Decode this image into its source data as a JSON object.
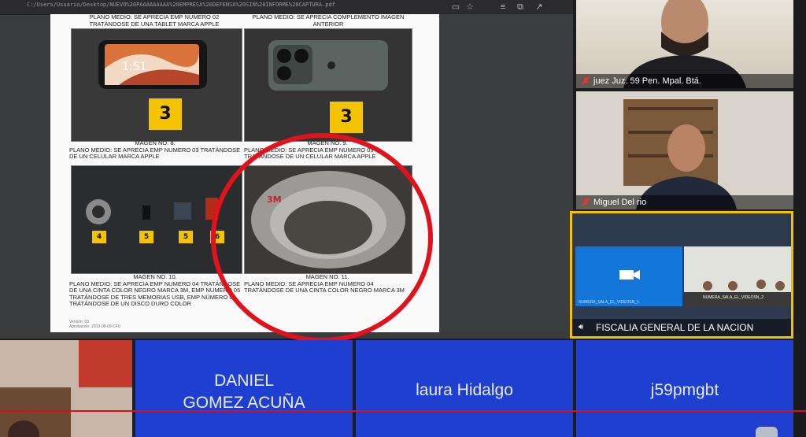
{
  "browser": {
    "url": "C:/Users/Usuario/Desktop/NUEVO%20PAAAAAAAAA%20EMPRESA%20DEFENSA%20SIN%20INFORME%20CAPTURA.pdf",
    "icons": [
      "tab-icon",
      "star-icon",
      "favorites-icon",
      "collections-icon",
      "share-icon"
    ]
  },
  "document": {
    "top_left_caption": "PLANO MEDIO: SE APRECIA EMP NUMERO 02 TRATÁNDOSE DE UNA TABLET MARCA APPLE",
    "top_right_caption": "PLANO MEDIO: SE APRECIA COMPLEMENTO IMAGEN ANTERIOR",
    "marker_top_left": "3",
    "marker_top_right": "3",
    "image8_label": "MAGEN No. 8.",
    "image8_caption": "PLANO MEDIO: SE APRECIA EMP NUMERO 03 TRATÁNDOSE DE UN CELULAR MARCA APPLE",
    "image9_label": "MAGEN No. 9.",
    "image9_caption": "PLANO MEDIO: SE APRECIA EMP NUMERO 03 TRATÁNDOSE DE UN CELULAR MARCA APPLE",
    "image10_label": "MAGEN No. 10.",
    "image10_caption": "PLANO MEDIO: SE APRECIA EMP NUMERO 04 TRATÁNDOSE DE UNA CINTA COLOR NEGRO MARCA 3M, EMP NUMERO 05 TRATÁNDOSE DE TRES MEMORIAS USB, EMP NÚMERO 06 TRATÁNDOSE DE UN DISCO DURO COLOR",
    "image11_label": "MAGEN No. 11.",
    "image11_caption": "PLANO MEDIO: SE APRECIA EMP NUMERO 04 TRATÁNDOSE DE UNA CINTA COLOR NEGRO MARCA 3M",
    "markers_bottom": [
      "4",
      "5",
      "5",
      "6"
    ],
    "footer_line1": "Versión: 03",
    "footer_line2": "Aprobación: 2019-08-09 CFU",
    "tape_text": "3M"
  },
  "videos": {
    "judge": {
      "name": "juez Juz. 59 Pen. Mpal. Btá."
    },
    "lawyer": {
      "name": "Miguel Del rio"
    },
    "fiscalia": {
      "name": "FISCALIA GENERAL DE LA NACION",
      "sub_left": "NUMERA_SALA_EL_VIDEOSN_1",
      "sub_right": "NUMERA_SALA_EL_VIDEOSN_2"
    }
  },
  "participants": [
    {
      "name_line1": "DANIEL",
      "name_line2": "GOMEZ ACUÑA"
    },
    {
      "name_line1": "laura Hidalgo",
      "name_line2": ""
    },
    {
      "name_line1": "j59pmgbt",
      "name_line2": ""
    }
  ],
  "colors": {
    "participant_tile": "#1f3fd0",
    "highlight_circle": "#e0121c",
    "active_speaker_border": "#f2c200",
    "marker_yellow": "#f5c400"
  }
}
